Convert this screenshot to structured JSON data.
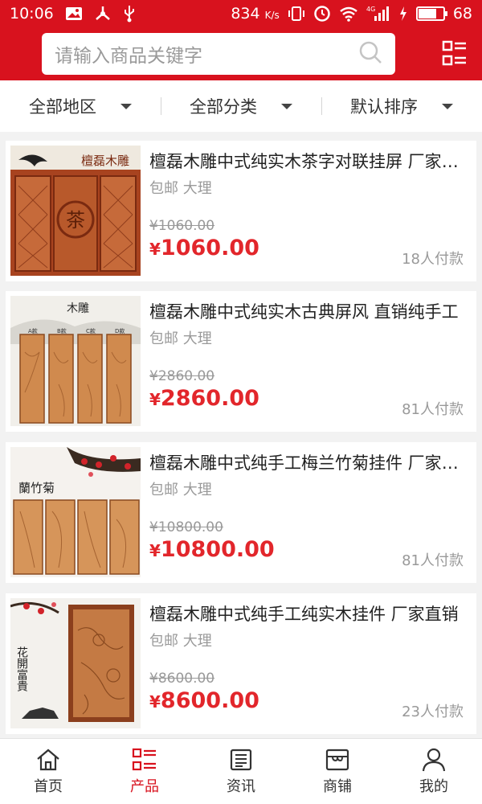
{
  "status_bar": {
    "time": "10:06",
    "speed": "834",
    "speed_unit": "K/s",
    "network": "4G",
    "battery": "68",
    "battery_level": 0.68
  },
  "search": {
    "placeholder": "请输入商品关键字"
  },
  "filters": [
    {
      "label": "全部地区"
    },
    {
      "label": "全部分类"
    },
    {
      "label": "默认排序"
    }
  ],
  "products": [
    {
      "title": "檀磊木雕中式纯实木茶字对联挂屏 厂家直销",
      "meta": "包邮 大理",
      "old_price": "¥1060.00",
      "currency": "¥",
      "price": "1060.00",
      "sold": "18人付款",
      "thumb_caption": "檀磊木雕"
    },
    {
      "title": "檀磊木雕中式纯实木古典屏风 直销纯手工",
      "meta": "包邮 大理",
      "old_price": "¥2860.00",
      "currency": "¥",
      "price": "2860.00",
      "sold": "81人付款",
      "thumb_caption": "木雕",
      "thumb_labels": [
        "A款",
        "B款",
        "C款",
        "D款"
      ]
    },
    {
      "title": "檀磊木雕中式纯手工梅兰竹菊挂件 厂家直销",
      "meta": "包邮 大理",
      "old_price": "¥10800.00",
      "currency": "¥",
      "price": "10800.00",
      "sold": "81人付款",
      "thumb_caption": "蘭竹菊"
    },
    {
      "title": "檀磊木雕中式纯手工纯实木挂件 厂家直销",
      "meta": "包邮 大理",
      "old_price": "¥8600.00",
      "currency": "¥",
      "price": "8600.00",
      "sold": "23人付款",
      "thumb_caption": "花開富貴"
    }
  ],
  "tabs": [
    {
      "label": "首页",
      "icon": "home-icon"
    },
    {
      "label": "产品",
      "icon": "product-list-icon",
      "active": true
    },
    {
      "label": "资讯",
      "icon": "news-icon"
    },
    {
      "label": "商铺",
      "icon": "store-icon"
    },
    {
      "label": "我的",
      "icon": "user-icon"
    }
  ],
  "colors": {
    "brand_red": "#d8121e",
    "price_red": "#e2262b"
  }
}
